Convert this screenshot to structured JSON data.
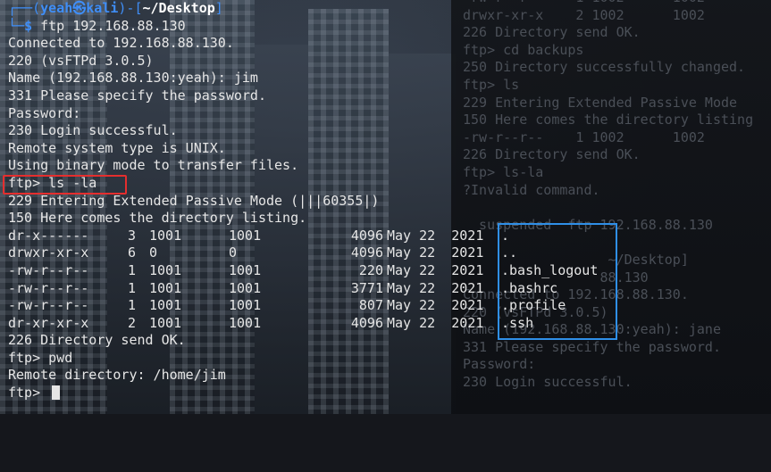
{
  "prompt": {
    "user": "yeah",
    "host": "kali",
    "skull": "㉿",
    "cwd": "~/Desktop",
    "dollar": "$",
    "command": "ftp 192.168.88.130"
  },
  "output_top": [
    "Connected to 192.168.88.130.",
    "220 (vsFTPd 3.0.5)",
    "Name (192.168.88.130:yeah): jim",
    "331 Please specify the password.",
    "Password:",
    "230 Login successful.",
    "Remote system type is UNIX.",
    "Using binary mode to transfer files."
  ],
  "ls_command": "ftp> ls -la",
  "output_mid": [
    "229 Entering Extended Passive Mode (|||60355|)",
    "150 Here comes the directory listing."
  ],
  "listing": [
    {
      "perm": "dr-x------",
      "links": "3",
      "owner": "1001",
      "group": "1001",
      "size": "4096",
      "date": "May 22  2021",
      "name": "."
    },
    {
      "perm": "drwxr-xr-x",
      "links": "6",
      "owner": "0",
      "group": "0",
      "size": "4096",
      "date": "May 22  2021",
      "name": ".."
    },
    {
      "perm": "-rw-r--r--",
      "links": "1",
      "owner": "1001",
      "group": "1001",
      "size": "220",
      "date": "May 22  2021",
      "name": ".bash_logout"
    },
    {
      "perm": "-rw-r--r--",
      "links": "1",
      "owner": "1001",
      "group": "1001",
      "size": "3771",
      "date": "May 22  2021",
      "name": ".bashrc"
    },
    {
      "perm": "-rw-r--r--",
      "links": "1",
      "owner": "1001",
      "group": "1001",
      "size": "807",
      "date": "May 22  2021",
      "name": ".profile"
    },
    {
      "perm": "dr-xr-xr-x",
      "links": "2",
      "owner": "1001",
      "group": "1001",
      "size": "4096",
      "date": "May 22  2021",
      "name": ".ssh"
    }
  ],
  "output_bottom": [
    "226 Directory send OK.",
    "ftp> pwd",
    "Remote directory: /home/jim"
  ],
  "final_prompt": "ftp> ",
  "background_terminal": [
    "-rw-r--r--    1 1002      1002",
    "drwxr-xr-x    2 1002      1002",
    "226 Directory send OK.",
    "ftp> cd backups",
    "250 Directory successfully changed.",
    "ftp> ls",
    "229 Entering Extended Passive Mode",
    "150 Here comes the directory listing",
    "-rw-r--r--    1 1002      1002",
    "226 Directory send OK.",
    "ftp> ls-la",
    "?Invalid command.",
    "",
    "  suspended  ftp 192.168.88.130",
    "",
    "                  ~/Desktop]",
    "                 88.130",
    "Connected to 192.168.88.130.",
    "220 (vsFTPd 3.0.5)",
    "Name (192.168.88.130:yeah): jane",
    "331 Please specify the password.",
    "Password:",
    "230 Login successful."
  ],
  "colors": {
    "prompt_blue": "#3f8ef7",
    "highlight_red": "#e52e2e",
    "highlight_blue": "#2f8fe8",
    "text": "#e6e6e6"
  }
}
